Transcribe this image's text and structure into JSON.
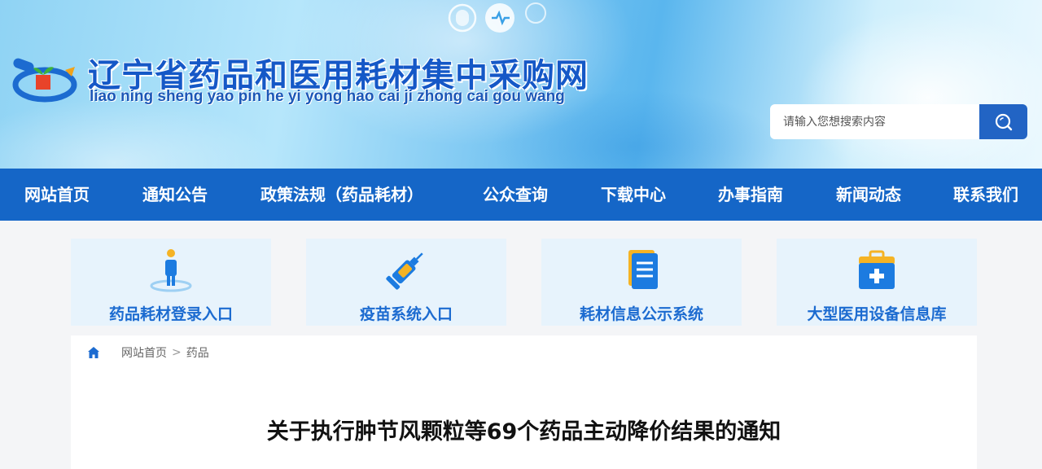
{
  "header": {
    "title": "辽宁省药品和医用耗材集中采购网",
    "pinyin": "liao ning sheng yao pin he yi yong hao cai ji zhong cai gou wang",
    "logo_icon": "site-logo",
    "search": {
      "placeholder": "请输入您想搜索内容",
      "value": "",
      "button_icon": "search-icon"
    }
  },
  "nav": {
    "items": [
      {
        "label": "网站首页"
      },
      {
        "label": "通知公告"
      },
      {
        "label": "政策法规（药品耗材）"
      },
      {
        "label": "公众查询"
      },
      {
        "label": "下载中心"
      },
      {
        "label": "办事指南"
      },
      {
        "label": "新闻动态"
      },
      {
        "label": "联系我们"
      }
    ]
  },
  "quick_entries": [
    {
      "label": "药品耗材登录入口",
      "icon": "person-icon"
    },
    {
      "label": "疫苗系统入口",
      "icon": "syringe-icon"
    },
    {
      "label": "耗材信息公示系统",
      "icon": "document-icon"
    },
    {
      "label": "大型医用设备信息库",
      "icon": "medical-kit-icon"
    }
  ],
  "breadcrumb": {
    "home_icon": "home-icon",
    "home_label": "网站首页",
    "separator": ">",
    "current": "药品"
  },
  "article": {
    "title": "关于执行肿节风颗粒等69个药品主动降价结果的通知"
  },
  "colors": {
    "primary": "#1566c7",
    "card_bg": "#e7f3fc",
    "card_text": "#1c6bd0",
    "title_blue": "#1558c7"
  }
}
